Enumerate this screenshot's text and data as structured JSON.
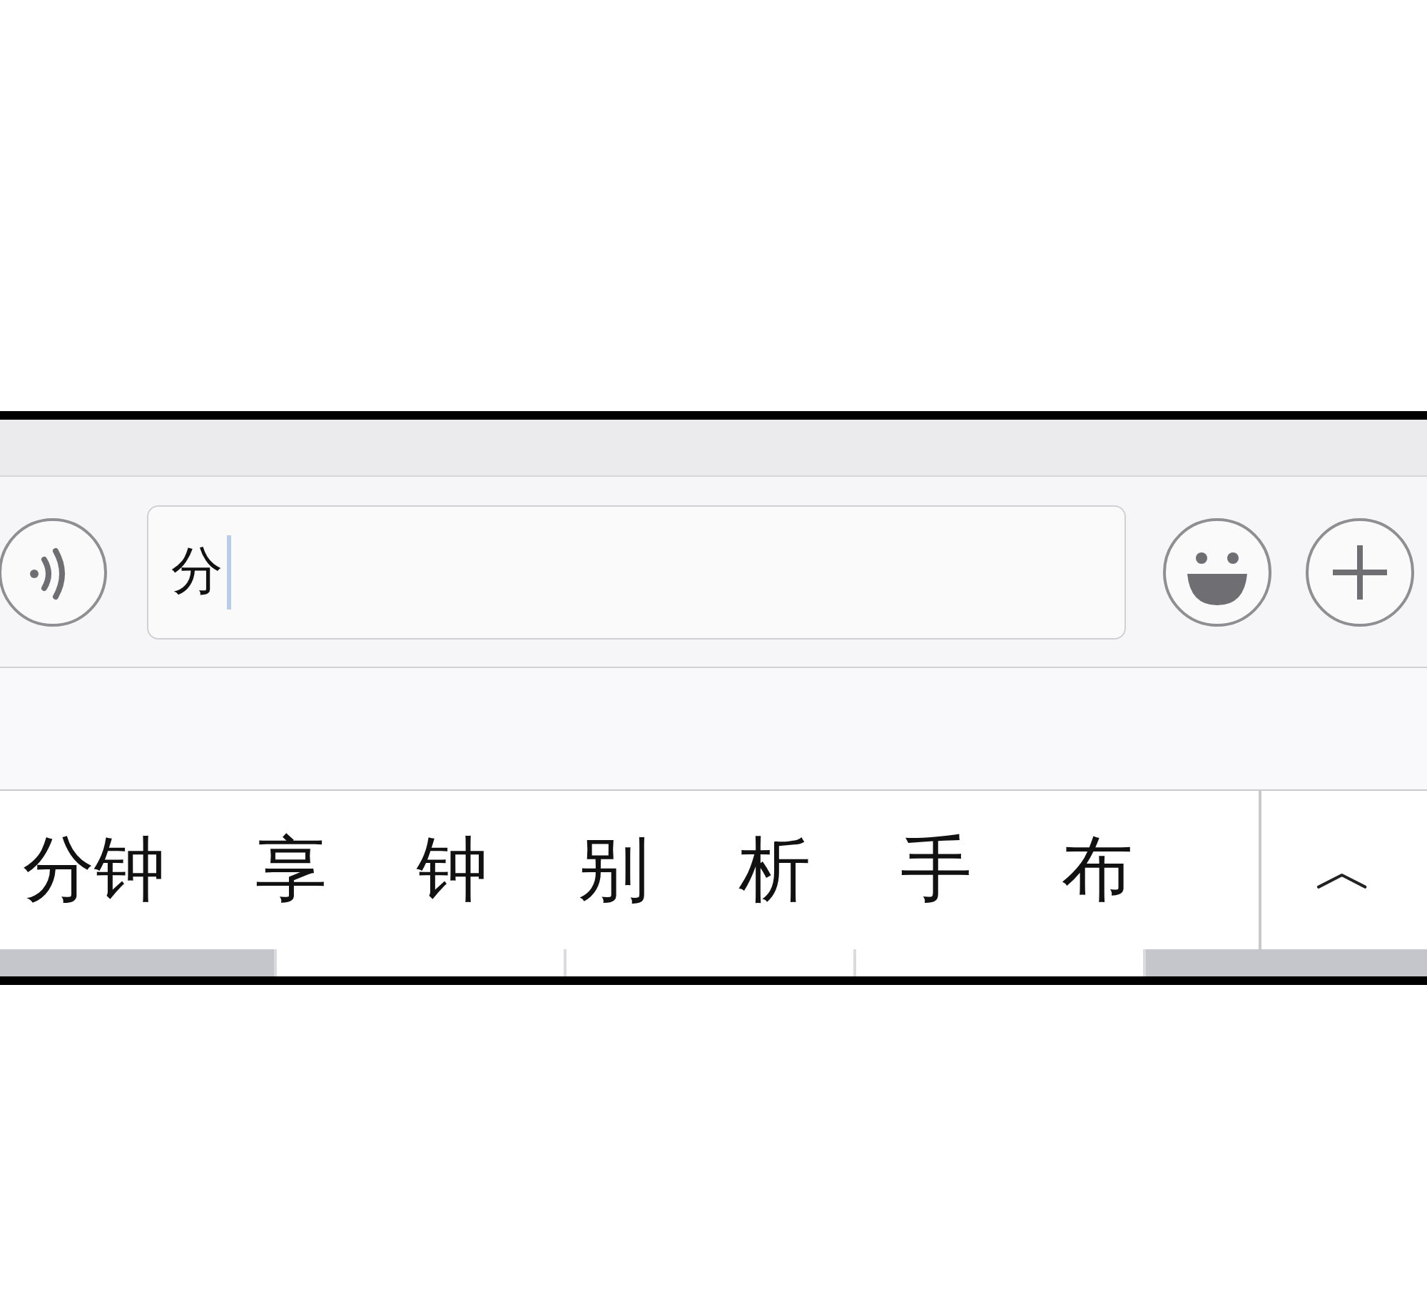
{
  "input_bar": {
    "value": "分"
  },
  "candidates": [
    {
      "text": "分钟"
    },
    {
      "text": "享"
    },
    {
      "text": "钟"
    },
    {
      "text": "别"
    },
    {
      "text": "析"
    },
    {
      "text": "手"
    },
    {
      "text": "布"
    }
  ],
  "expand_button": {
    "label": "︿"
  }
}
